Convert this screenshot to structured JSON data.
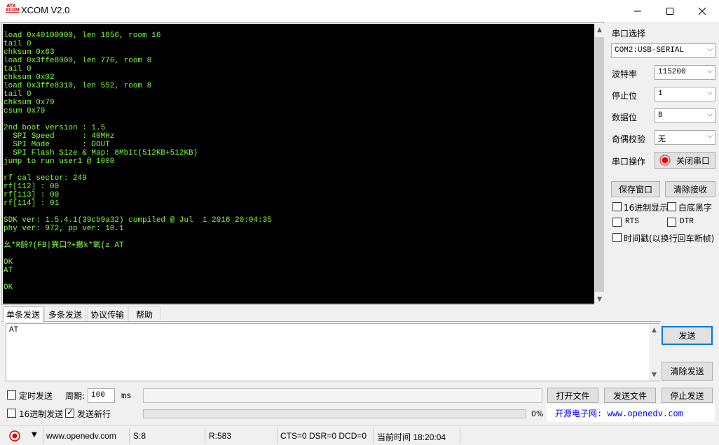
{
  "window": {
    "title": "XCOM V2.0",
    "logo_text_top": "ATK",
    "logo_text_bottom": "XCOM"
  },
  "receive": {
    "lines": "load 0x40100000, len 1856, room 16\ntail 0\nchksum 0x63\nload 0x3ffe8000, len 776, room 8\ntail 0\nchksum 0x02\nload 0x3ffe8310, len 552, room 8\ntail 0\nchksum 0x79\ncsum 0x79\n\n2nd boot version : 1.5\n  SPI Speed      : 40MHz\n  SPI Mode       : DOUT\n  SPI Flash Size & Map: 8Mbit(512KB+512KB)\njump to run user1 @ 1000\n\nrf cal sector: 249\nrf[112] : 00\nrf[113] : 00\nrf[114] : 01\n\nSDK ver: 1.5.4.1(39cb9a32) compiled @ Jul  1 2016 20:04:35\nphy ver: 972, pp ver: 10.1\n\n幺*R龄?(FB|巽口?+撇k*氧(z AT\n\nOK\nAT\n\nOK"
  },
  "settings": {
    "port_label": "串口选择",
    "port_value": "COM2:USB-SERIAL",
    "baud_label": "波特率",
    "baud_value": "115200",
    "stop_label": "停止位",
    "stop_value": "1",
    "data_label": "数据位",
    "data_value": "8",
    "parity_label": "奇偶校验",
    "parity_value": "无",
    "op_label": "串口操作",
    "op_button": "关闭串口",
    "save_window": "保存窗口",
    "clear_recv": "清除接收",
    "hex_display": "16进制显示",
    "white_bg": "白底黑字",
    "rts": "RTS",
    "dtr": "DTR",
    "timestamp": "时间戳(以换行回车断帧)"
  },
  "tabs": [
    "单条发送",
    "多条发送",
    "协议传输",
    "帮助"
  ],
  "send": {
    "text": "AT",
    "send_button": "发送",
    "clear_send": "清除发送",
    "timed_send": "定时发送",
    "period_label": "周期:",
    "period_value": "100",
    "period_unit": "ms",
    "open_file": "打开文件",
    "send_file": "发送文件",
    "stop_send": "停止发送",
    "hex_send": "16进制发送",
    "newline": "发送新行",
    "progress": "0%",
    "ad_text": "开源电子网: www.openedv.com"
  },
  "status": {
    "url": "www.openedv.com",
    "sent": "S:8",
    "received": "R:583",
    "lines": "CTS=0 DSR=0 DCD=0",
    "time": "当前时间 18:20:04"
  },
  "colors": {
    "terminal_bg": "#000000",
    "terminal_fg": "#7fff3f",
    "ad_text": "#0000ff",
    "record_red": "#e00000"
  }
}
